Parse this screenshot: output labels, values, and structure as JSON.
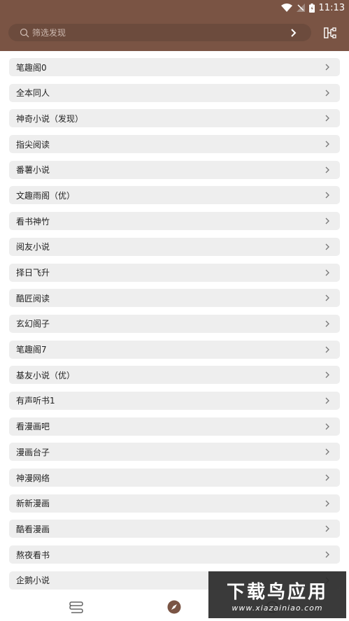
{
  "status_bar": {
    "time": "11:13",
    "icons": [
      "wifi-icon",
      "signal-off-icon",
      "battery-icon"
    ]
  },
  "search": {
    "placeholder": "筛选发现",
    "value": ""
  },
  "header_actions": {
    "group_icon": "tree-structure-icon"
  },
  "sources": [
    "笔趣阁0",
    "全本同人",
    "神奇小说（发现）",
    "指尖阅读",
    "番薯小说",
    "文趣雨阁（优）",
    "看书神竹",
    "阅友小说",
    "择日飞升",
    "酷匠阅读",
    "玄幻阁子",
    "笔趣阁7",
    "基友小说（优）",
    "有声听书1",
    "看漫画吧",
    "漫画台子",
    "神漫网络",
    "新新漫画",
    "酷看漫画",
    "熬夜看书",
    "企鹅小说"
  ],
  "bottom_nav": {
    "items": [
      "bookshelf-icon",
      "compass-icon",
      "rss-icon"
    ]
  },
  "watermark": {
    "title": "下载鸟应用",
    "url": "www.xiazainiao.com"
  },
  "colors": {
    "header": "#7a5444",
    "search_bg": "#6c4b3d",
    "item_bg": "#eeeeee",
    "accent": "#7a5444"
  }
}
